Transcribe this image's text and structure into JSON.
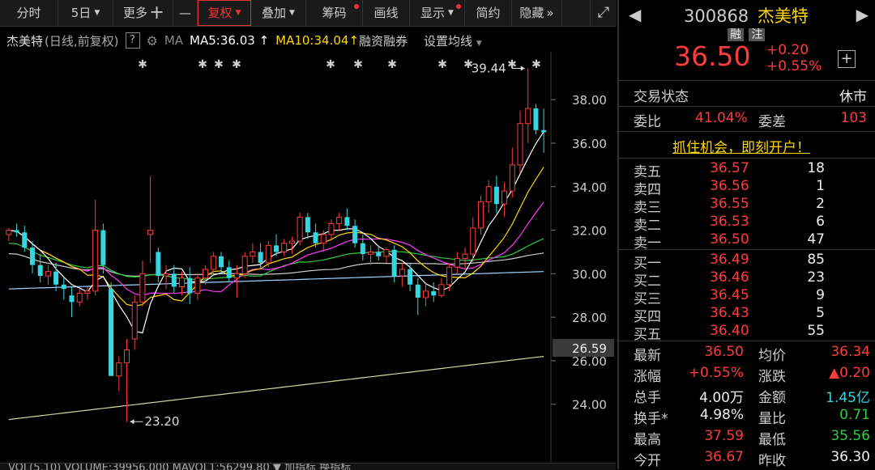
{
  "toolbar": {
    "items": [
      {
        "label": "分时",
        "caret": false,
        "active": false,
        "dot": false
      },
      {
        "label": "5日",
        "caret": true,
        "active": false,
        "dot": false
      },
      {
        "label": "更多",
        "caret": false,
        "active": false,
        "dot": false,
        "plus": true
      },
      {
        "label": "—",
        "caret": false,
        "active": false,
        "dot": false
      },
      {
        "label": "复权",
        "caret": true,
        "active": true,
        "dot": false
      },
      {
        "label": "叠加",
        "caret": true,
        "active": false,
        "dot": false
      },
      {
        "label": "筹码",
        "caret": false,
        "active": false,
        "dot": true
      },
      {
        "label": "画线",
        "caret": false,
        "active": false,
        "dot": false
      },
      {
        "label": "显示",
        "caret": true,
        "active": false,
        "dot": true
      },
      {
        "label": "简约",
        "caret": false,
        "active": false,
        "dot": false
      },
      {
        "label": "隐藏",
        "caret": false,
        "active": false,
        "dot": false,
        "chev": true
      }
    ],
    "plus_glyph": "十",
    "chev_glyph": "»",
    "expand_glyph": "⤢"
  },
  "info": {
    "name": "杰美特",
    "mode": "(日线,前复权)",
    "help": "?",
    "ma_label": "MA",
    "ma5": "MA5:36.03",
    "ma10": "MA10:34.04",
    "finance": "融资融券",
    "settings": "设置均线"
  },
  "colors": {
    "up": "#ff3b3b",
    "down": "#36d5e0",
    "ma5": "#ffffff",
    "ma10": "#ffd700",
    "ma20": "#ff3bff",
    "ma30": "#2ecc40",
    "ma60": "#cccccc",
    "ma120": "#9fd3ff",
    "ma250": "#d6d6a0"
  },
  "chart_data": {
    "type": "candlestick",
    "ylim": [
      22.8,
      40.2
    ],
    "yticks": [
      "38.00",
      "36.00",
      "34.00",
      "32.00",
      "30.00",
      "28.00",
      "26.00",
      "24.00"
    ],
    "ytick_values": [
      38,
      36,
      34,
      32,
      30,
      28,
      26,
      24
    ],
    "current_price_label": "26.59",
    "current_price_value": 26.59,
    "high_annotation": "39.44",
    "low_annotation": "23.20",
    "candles": [
      [
        31.8,
        32.1,
        31.5,
        32.0
      ],
      [
        32.0,
        32.3,
        31.7,
        31.9
      ],
      [
        31.9,
        32.2,
        31.0,
        31.2
      ],
      [
        31.2,
        31.5,
        30.0,
        30.4
      ],
      [
        30.4,
        30.9,
        29.6,
        29.9
      ],
      [
        29.9,
        30.4,
        29.5,
        30.1
      ],
      [
        30.1,
        30.5,
        29.2,
        29.5
      ],
      [
        29.5,
        29.8,
        28.8,
        29.3
      ],
      [
        29.0,
        29.4,
        28.0,
        28.7
      ],
      [
        28.7,
        29.3,
        28.5,
        29.1
      ],
      [
        29.1,
        29.4,
        28.8,
        29.2
      ],
      [
        29.2,
        33.4,
        29.0,
        32.0
      ],
      [
        32.0,
        32.3,
        30.0,
        30.4
      ],
      [
        29.3,
        29.6,
        25.4,
        25.3
      ],
      [
        25.3,
        26.2,
        24.6,
        25.9
      ],
      [
        25.9,
        27.0,
        23.2,
        26.5
      ],
      [
        27.0,
        29.0,
        26.5,
        28.7
      ],
      [
        28.7,
        30.6,
        28.5,
        30.0
      ],
      [
        31.8,
        34.5,
        30.5,
        32.0
      ],
      [
        31.0,
        31.2,
        29.6,
        29.9
      ],
      [
        29.9,
        30.4,
        29.3,
        30.0
      ],
      [
        30.0,
        30.4,
        29.1,
        29.4
      ],
      [
        29.4,
        30.1,
        29.0,
        29.8
      ],
      [
        29.8,
        30.3,
        28.6,
        29.1
      ],
      [
        29.1,
        30.0,
        28.8,
        29.8
      ],
      [
        29.8,
        30.4,
        29.5,
        30.2
      ],
      [
        30.2,
        31.0,
        30.0,
        30.8
      ],
      [
        30.8,
        31.0,
        30.0,
        30.3
      ],
      [
        30.3,
        30.6,
        29.6,
        29.8
      ],
      [
        29.8,
        30.4,
        28.9,
        30.0
      ],
      [
        30.0,
        31.0,
        29.8,
        30.8
      ],
      [
        30.8,
        31.4,
        30.5,
        31.0
      ],
      [
        31.0,
        31.4,
        30.2,
        30.5
      ],
      [
        30.5,
        31.5,
        30.3,
        31.3
      ],
      [
        31.3,
        31.8,
        30.8,
        31.0
      ],
      [
        31.0,
        31.6,
        30.8,
        31.4
      ],
      [
        31.4,
        31.7,
        30.9,
        31.5
      ],
      [
        31.5,
        32.8,
        31.3,
        32.6
      ],
      [
        32.6,
        32.8,
        31.6,
        31.9
      ],
      [
        31.9,
        32.3,
        31.2,
        31.4
      ],
      [
        31.4,
        32.0,
        31.0,
        31.8
      ],
      [
        31.8,
        32.5,
        31.6,
        32.3
      ],
      [
        32.3,
        32.8,
        32.0,
        32.6
      ],
      [
        32.6,
        33.0,
        32.0,
        32.2
      ],
      [
        32.2,
        32.5,
        31.2,
        31.4
      ],
      [
        31.4,
        31.8,
        30.6,
        30.9
      ],
      [
        30.9,
        31.3,
        30.4,
        31.0
      ],
      [
        31.0,
        31.3,
        30.6,
        30.8
      ],
      [
        30.8,
        31.2,
        30.5,
        31.1
      ],
      [
        31.1,
        31.3,
        29.6,
        29.9
      ],
      [
        29.9,
        30.5,
        29.4,
        30.2
      ],
      [
        30.2,
        30.5,
        29.2,
        29.5
      ],
      [
        29.5,
        29.8,
        28.1,
        28.9
      ],
      [
        28.9,
        29.6,
        28.5,
        29.2
      ],
      [
        29.2,
        29.6,
        28.7,
        29.0
      ],
      [
        29.0,
        29.8,
        28.9,
        29.5
      ],
      [
        29.5,
        30.5,
        29.2,
        30.3
      ],
      [
        30.3,
        31.0,
        30.0,
        30.7
      ],
      [
        30.7,
        31.2,
        30.2,
        30.9
      ],
      [
        30.9,
        32.6,
        30.5,
        32.1
      ],
      [
        32.1,
        33.6,
        31.8,
        33.3
      ],
      [
        33.3,
        34.3,
        32.8,
        34.0
      ],
      [
        34.0,
        34.5,
        32.8,
        33.2
      ],
      [
        33.2,
        34.2,
        32.6,
        33.8
      ],
      [
        33.8,
        35.8,
        33.5,
        35.0
      ],
      [
        35.0,
        37.5,
        34.6,
        36.9
      ],
      [
        36.9,
        39.44,
        36.0,
        37.6
      ],
      [
        37.6,
        37.8,
        36.4,
        36.6
      ],
      [
        36.6,
        37.59,
        35.56,
        36.5
      ]
    ]
  },
  "quote": {
    "code": "300868",
    "name": "杰美特",
    "tag1": "融",
    "tag2": "注",
    "price": "36.50",
    "change": "+0.20",
    "change_pct": "+0.55%",
    "plus_glyph": "+",
    "status_label": "交易状态",
    "status_value": "休市",
    "ratio_label": "委比",
    "ratio_value": "41.04%",
    "diff_label": "委差",
    "diff_value": "103",
    "promo": "抓住机会，即刻开户！",
    "asks": [
      {
        "label": "卖五",
        "price": "36.57",
        "vol": "18"
      },
      {
        "label": "卖四",
        "price": "36.56",
        "vol": "1"
      },
      {
        "label": "卖三",
        "price": "36.55",
        "vol": "2"
      },
      {
        "label": "卖二",
        "price": "36.53",
        "vol": "6"
      },
      {
        "label": "卖一",
        "price": "36.50",
        "vol": "47"
      }
    ],
    "bids": [
      {
        "label": "买一",
        "price": "36.49",
        "vol": "85"
      },
      {
        "label": "买二",
        "price": "36.46",
        "vol": "23"
      },
      {
        "label": "买三",
        "price": "36.45",
        "vol": "9"
      },
      {
        "label": "买四",
        "price": "36.43",
        "vol": "5"
      },
      {
        "label": "买五",
        "price": "36.40",
        "vol": "55"
      }
    ],
    "stats": [
      {
        "l1": "最新",
        "v1": "36.50",
        "c1": "red",
        "l2": "均价",
        "v2": "36.34",
        "c2": "red"
      },
      {
        "l1": "涨幅",
        "v1": "+0.55%",
        "c1": "red",
        "l2": "涨跌",
        "v2": "▲0.20",
        "c2": "red"
      },
      {
        "l1": "总手",
        "v1": "4.00万",
        "c1": "white",
        "l2": "金额",
        "v2": "1.45亿",
        "c2": "cyan"
      },
      {
        "l1": "换手*",
        "v1": "4.98%",
        "c1": "white",
        "l2": "量比",
        "v2": "0.71",
        "c2": "green"
      },
      {
        "l1": "最高",
        "v1": "37.59",
        "c1": "red",
        "l2": "最低",
        "v2": "35.56",
        "c2": "green"
      },
      {
        "l1": "今开",
        "v1": "36.67",
        "c1": "red",
        "l2": "昨收",
        "v2": "36.30",
        "c2": "white"
      }
    ]
  },
  "bottombar": {
    "text": "VOL(5,10)  VOLUME:39956.000  MAVOL1:56299.80  ▼ 加指标  换指标"
  }
}
